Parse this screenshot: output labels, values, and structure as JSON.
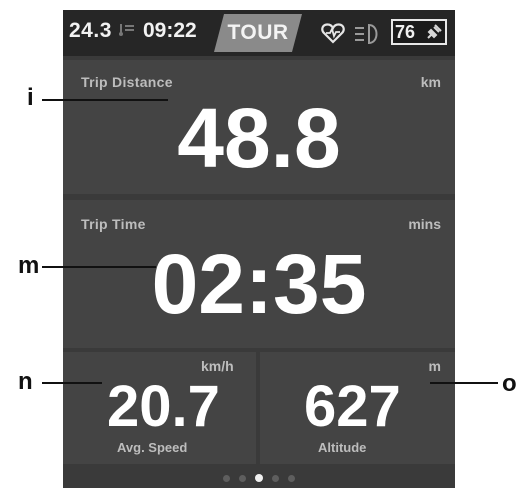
{
  "status_bar": {
    "date": "24.3",
    "temperature_mark": "°",
    "time": "09:22",
    "mode": "TOUR",
    "heart_icon": "heart-rate-icon",
    "light_icon": "headlight-icon",
    "battery_percent": "76",
    "charging_icon": "plug-icon"
  },
  "trip_distance": {
    "label": "Trip Distance",
    "unit": "km",
    "value": "48.8"
  },
  "trip_time": {
    "label": "Trip Time",
    "unit": "mins",
    "value": "02:35"
  },
  "avg_speed": {
    "label": "Avg. Speed",
    "unit": "km/h",
    "value": "20.7"
  },
  "altitude": {
    "label": "Altitude",
    "unit": "m",
    "value": "627"
  },
  "page_indicator": {
    "count": 5,
    "active": 3
  },
  "callouts": {
    "i": "i",
    "m": "m",
    "n": "n",
    "o": "o"
  },
  "colors": {
    "background": "#3a3a3a",
    "panel": "#444444",
    "text": "#ffffff",
    "label": "#bdbdbd"
  }
}
